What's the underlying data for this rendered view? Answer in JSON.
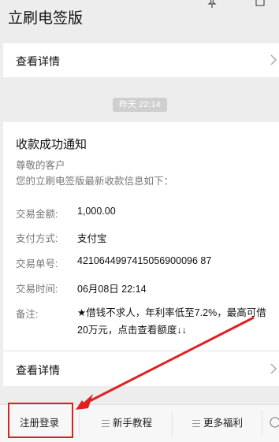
{
  "app": {
    "title": "立刷电签版"
  },
  "top_card": {
    "details_label": "查看详情"
  },
  "timestamp": "昨天  22:14",
  "message": {
    "title": "收款成功通知",
    "greeting": "尊敬的客户",
    "intro": "您的立刷电签版最新收款信息如下：",
    "rows": [
      {
        "label": "交易金额:",
        "value": "1,000.00"
      },
      {
        "label": "支付方式:",
        "value": "支付宝"
      },
      {
        "label": "交易单号:",
        "value": "4210644997415056900096 87"
      },
      {
        "label": "交易时间:",
        "value": "06月08日 22:14"
      }
    ],
    "remark_label": "备注:",
    "remark_value": "★借钱不求人，年利率低至7.2%，最高可借20万元，点击查看额度↓↓",
    "details_label": "查看详情"
  },
  "bottom_menu": {
    "items": [
      "注册登录",
      "新手教程",
      "更多福利"
    ]
  },
  "colors": {
    "background": "#ededed",
    "card": "#ffffff",
    "highlight": "#e02020"
  },
  "icons": [
    "pin-icon",
    "window-icon",
    "chevron-right-icon",
    "menu-icon",
    "keyboard-icon"
  ]
}
